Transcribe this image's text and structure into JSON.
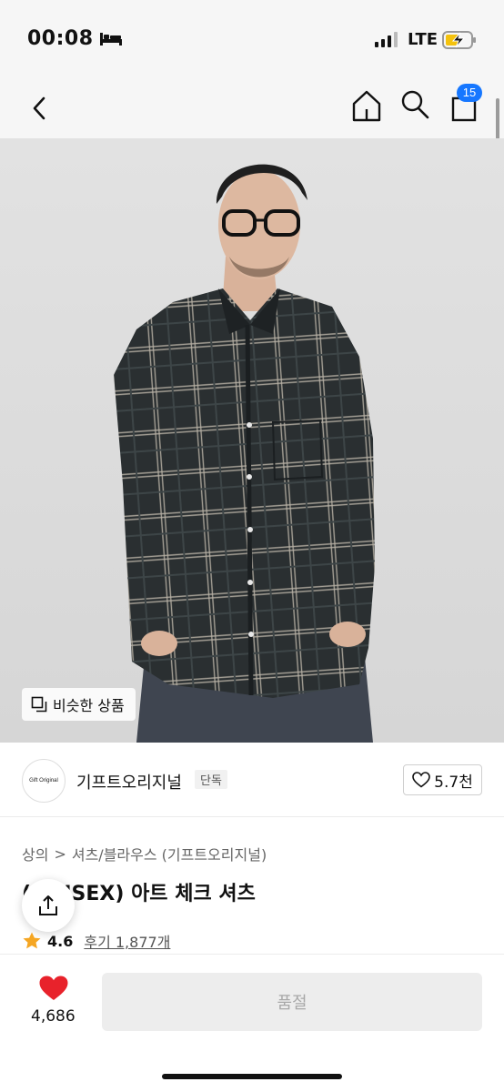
{
  "status": {
    "time": "00:08",
    "network": "LTE"
  },
  "nav": {
    "cart_count": "15"
  },
  "hero": {
    "similar_label": "비슷한 상품"
  },
  "brand": {
    "logo_text": "Gift Original",
    "name": "기프트오리지널",
    "exclusive": "단독",
    "likes": "5.7천"
  },
  "product": {
    "breadcrumb": [
      "상의",
      ">",
      "셔츠/블라우스 (기프트오리지널)"
    ],
    "title": "(UNISEX) 아트 체크 셔츠",
    "rating": "4.6",
    "reviews": "후기 1,877개"
  },
  "bottom": {
    "wish_count": "4,686",
    "buy_label": "품절"
  },
  "colors": {
    "accent": "#1677ff",
    "heart": "#e8222b",
    "star": "#f5a623"
  }
}
